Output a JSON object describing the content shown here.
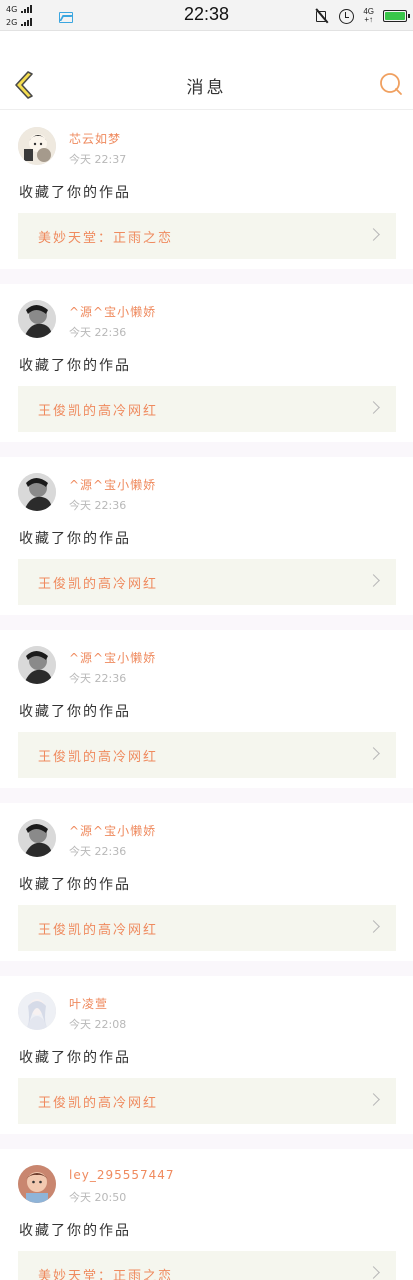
{
  "status_bar": {
    "sim1": "4G",
    "sim2": "2G",
    "time": "22:38",
    "net": "4G",
    "net_sub": "+↑",
    "colors": {
      "battery": "#39c64a",
      "picture_icon": "#3ba6e0"
    }
  },
  "header": {
    "title": "消息",
    "icons": {
      "back": "chevron-left-icon",
      "search": "search-icon"
    },
    "colors": {
      "back_fill": "#f5dd4f",
      "back_stroke": "#4a4a4a",
      "search": "#f0a060"
    }
  },
  "colors": {
    "accent": "#ef8a5e",
    "work_box_bg": "#f5f6ee",
    "separator": "#faf7fb"
  },
  "notifications": [
    {
      "username": "芯云如梦",
      "time": "今天 22:37",
      "action": "收藏了你的作品",
      "work": "美妙天堂：正雨之恋",
      "avatar": "avatar-anime"
    },
    {
      "username": "^源^宝小懒娇",
      "time": "今天 22:36",
      "action": "收藏了你的作品",
      "work": "王俊凯的高冷网红",
      "avatar": "avatar-bw"
    },
    {
      "username": "^源^宝小懒娇",
      "time": "今天 22:36",
      "action": "收藏了你的作品",
      "work": "王俊凯的高冷网红",
      "avatar": "avatar-bw"
    },
    {
      "username": "^源^宝小懒娇",
      "time": "今天 22:36",
      "action": "收藏了你的作品",
      "work": "王俊凯的高冷网红",
      "avatar": "avatar-bw"
    },
    {
      "username": "^源^宝小懒娇",
      "time": "今天 22:36",
      "action": "收藏了你的作品",
      "work": "王俊凯的高冷网红",
      "avatar": "avatar-bw"
    },
    {
      "username": "叶凌萱",
      "time": "今天 22:08",
      "action": "收藏了你的作品",
      "work": "王俊凯的高冷网红",
      "avatar": "avatar-pale"
    },
    {
      "username": "ley_295557447",
      "time": "今天 20:50",
      "action": "收藏了你的作品",
      "work": "美妙天堂：正雨之恋",
      "avatar": "avatar-photo"
    }
  ]
}
